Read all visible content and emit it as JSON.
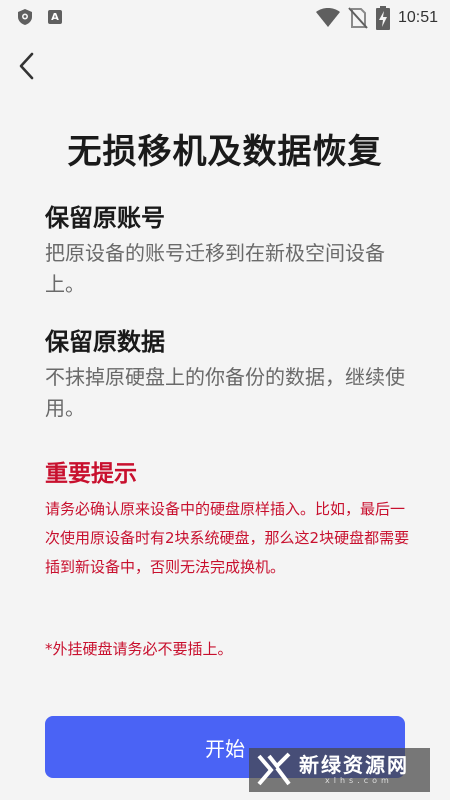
{
  "status_bar": {
    "time": "10:51",
    "icons": [
      "shield-icon",
      "a-icon",
      "wifi-icon",
      "no-sim-icon",
      "battery-charging-icon"
    ]
  },
  "header": {
    "back_icon": "chevron-left-icon"
  },
  "title": "无损移机及数据恢复",
  "sections": [
    {
      "heading": "保留原账号",
      "text": "把原设备的账号迁移到在新极空间设备上。"
    },
    {
      "heading": "保留原数据",
      "text": "不抹掉原硬盘上的你备份的数据，继续使用。"
    }
  ],
  "warning": {
    "heading": "重要提示",
    "text": "请务必确认原来设备中的硬盘原样插入。比如，最后一次使用原设备时有2块系统硬盘，那么这2块硬盘都需要插到新设备中，否则无法完成换机。",
    "note": "*外挂硬盘请务必不要插上。"
  },
  "button": {
    "label": "开始"
  },
  "watermark": {
    "text": "新绿资源网",
    "sub": "xlhs.com"
  },
  "colors": {
    "accent": "#4a63f5",
    "warning": "#c8102e",
    "background": "#f4f4f4"
  }
}
